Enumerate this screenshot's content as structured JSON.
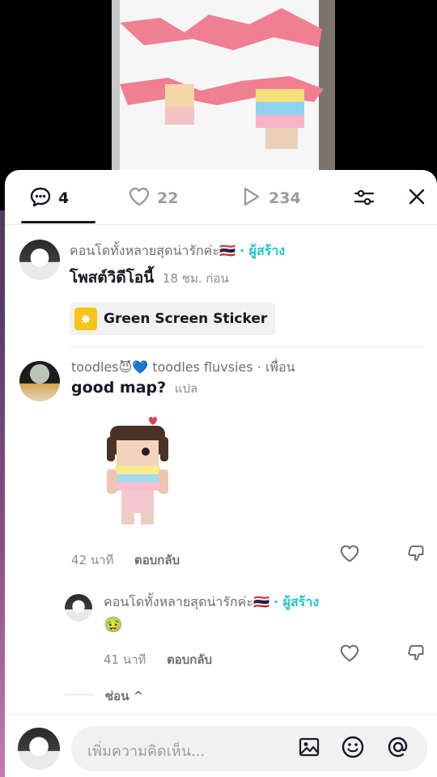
{
  "stats": {
    "comments_count": "4",
    "likes_count": "22",
    "views_count": "234"
  },
  "icons": {
    "comments": "speech-bubble-icon",
    "likes": "heart-icon",
    "views": "play-icon",
    "filter": "sliders-icon",
    "close": "close-icon",
    "sticker": "sparkle-icon",
    "image": "image-icon",
    "emoji": "smiley-icon",
    "mention": "at-icon"
  },
  "comments": [
    {
      "username": "คอนโดทั้งหลายสุดน่ารักค่ะ🇹🇭",
      "badge": "· ผู้สร้าง",
      "text": "โพสต์วิดีโอนี้",
      "time": "18 ชม. ก่อน",
      "sticker_label": "Green Screen Sticker"
    },
    {
      "username": "toodles😈💙 toodles fluvsies",
      "badge": "· เพื่อน",
      "text": "good map?",
      "translate": "แปล",
      "time": "42 นาที",
      "reply": "ตอบกลับ"
    },
    {
      "username": "คอนโดทั้งหลายสุดน่ารักค่ะ🇹🇭",
      "badge": "· ผู้สร้าง",
      "text": "🤢",
      "time": "41 นาที",
      "reply": "ตอบกลับ"
    }
  ],
  "hide_replies": "ซ่อน ^",
  "composer": {
    "placeholder": "เพิ่มความคิดเห็น..."
  },
  "colors": {
    "creator_accent": "#20c4c9",
    "text_primary": "#161823",
    "text_secondary": "#8a8b91"
  }
}
